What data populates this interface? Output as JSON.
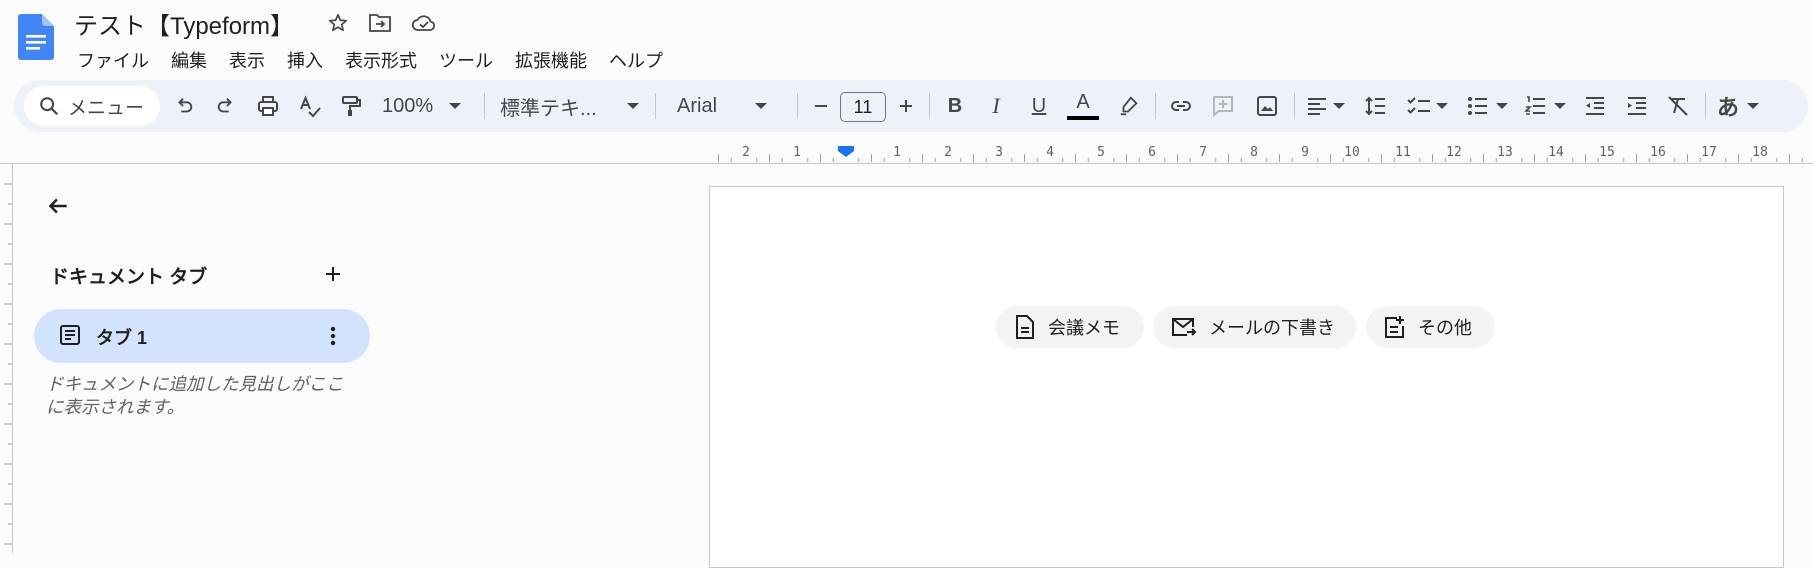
{
  "document": {
    "title": "テスト【Typeform】"
  },
  "menubar": [
    "ファイル",
    "編集",
    "表示",
    "挿入",
    "表示形式",
    "ツール",
    "拡張機能",
    "ヘルプ"
  ],
  "toolbar": {
    "search_label": "メニュー",
    "zoom": "100%",
    "style": "標準テキ...",
    "font": "Arial",
    "font_size": "11",
    "bold": "B",
    "italic": "I",
    "underline": "U",
    "text_color": "A",
    "input_tools": "あ"
  },
  "ruler": {
    "left_ticks": [
      "2",
      "1"
    ],
    "ticks": [
      "1",
      "2",
      "3",
      "4",
      "5",
      "6",
      "7",
      "8",
      "9",
      "10",
      "11",
      "12",
      "13",
      "14",
      "15",
      "16",
      "17",
      "18"
    ]
  },
  "sidebar": {
    "heading": "ドキュメント タブ",
    "tabs": [
      {
        "label": "タブ 1"
      }
    ],
    "hint": "ドキュメントに追加した見出しがここに表示されます。"
  },
  "page": {
    "chips": [
      {
        "label": "会議メモ",
        "icon": "doc-icon"
      },
      {
        "label": "メールの下書き",
        "icon": "mail-icon"
      },
      {
        "label": "その他",
        "icon": "add-note-icon"
      }
    ]
  },
  "colors": {
    "accent": "#1a73e8",
    "toolbar_bg": "#edf2fa",
    "selected_tab": "#d3e3fd"
  }
}
